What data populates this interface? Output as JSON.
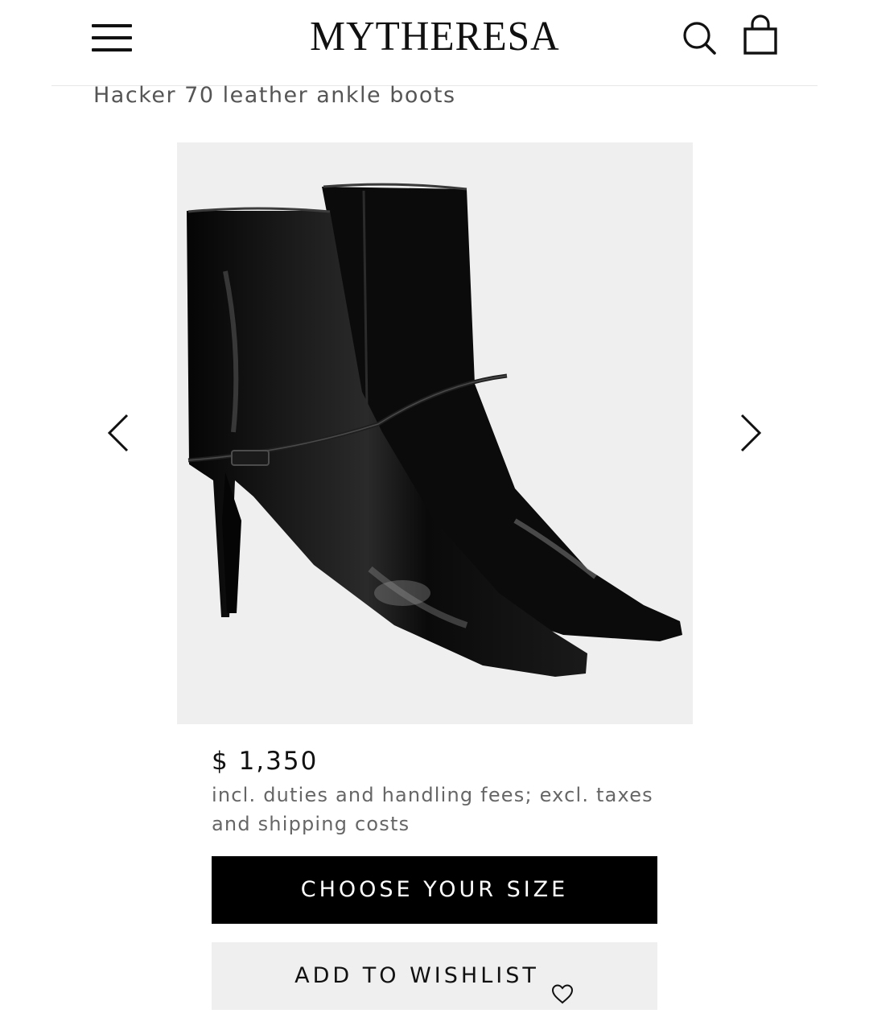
{
  "header": {
    "logo": "MYTHERESA",
    "menu_icon": "hamburger-menu-icon",
    "search_icon": "search-icon",
    "cart_icon": "shopping-bag-icon"
  },
  "product": {
    "title": "Hacker 70 leather ankle boots",
    "image_icon": "black-patent-ankle-boots-image",
    "price": "$ 1,350",
    "price_note": "incl. duties and handling fees; excl. taxes and shipping costs"
  },
  "gallery": {
    "prev_icon": "chevron-left-icon",
    "next_icon": "chevron-right-icon"
  },
  "actions": {
    "choose_size_label": "CHOOSE YOUR SIZE",
    "wishlist_label": "ADD TO WISHLIST",
    "wishlist_icon": "heart-icon"
  },
  "colors": {
    "primary_button": "#000000",
    "secondary_button": "#efefef",
    "image_background": "#efefef",
    "muted_text": "#666666"
  }
}
